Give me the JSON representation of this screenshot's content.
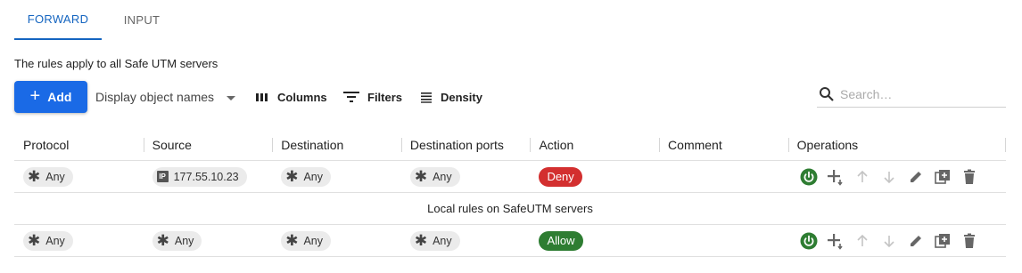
{
  "tabs": [
    {
      "label": "FORWARD",
      "active": true
    },
    {
      "label": "INPUT",
      "active": false
    }
  ],
  "info_text": "The rules apply to all Safe UTM servers",
  "toolbar": {
    "add_label": "Add",
    "display_label": "Display object names",
    "columns_label": "Columns",
    "filters_label": "Filters",
    "density_label": "Density",
    "search_placeholder": "Search…"
  },
  "columns": [
    "Protocol",
    "Source",
    "Destination",
    "Destination ports",
    "Action",
    "Comment",
    "Operations"
  ],
  "rows": [
    {
      "protocol": "Any",
      "source": "177.55.10.23",
      "source_type": "ip",
      "destination": "Any",
      "ports": "Any",
      "action": "Deny",
      "comment": ""
    }
  ],
  "group_label": "Local rules on SafeUTM servers",
  "local_rows": [
    {
      "protocol": "Any",
      "source": "Any",
      "destination": "Any",
      "ports": "Any",
      "action": "Allow",
      "comment": ""
    }
  ],
  "colors": {
    "accent": "#1a6ae6",
    "deny": "#d32f2f",
    "allow": "#2e7d32",
    "power": "#2e7d32"
  }
}
